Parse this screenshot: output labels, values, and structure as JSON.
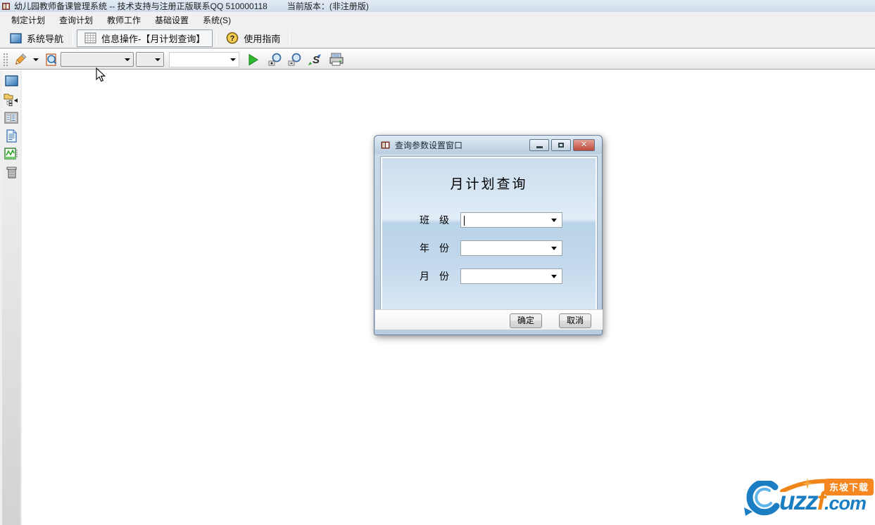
{
  "app": {
    "title": "幼儿园教师备课管理系统 -- 技术支持与注册正版联系QQ 510000118",
    "version": "当前版本：(非注册版)"
  },
  "menu": {
    "items": [
      "制定计划",
      "查询计划",
      "教师工作",
      "基础设置",
      "系统(S)"
    ]
  },
  "navbar": {
    "system_nav_label": "系统导航",
    "info_tab_label": "信息操作-【月计划查询】",
    "guide_label": "使用指南"
  },
  "toolbar": {
    "combo1_value": "",
    "combo2_value": "",
    "combo3_value": ""
  },
  "dialog": {
    "title": "查询参数设置窗口",
    "heading": "月计划查询",
    "fields": [
      {
        "label": "班　级",
        "value": ""
      },
      {
        "label": "年　份",
        "value": ""
      },
      {
        "label": "月　份",
        "value": ""
      }
    ],
    "ok_label": "确定",
    "cancel_label": "取消"
  },
  "watermark": {
    "brand_prefix": "uzz",
    "brand_f": "f",
    "suffix": ".com",
    "badge": "东坡下载"
  },
  "colors": {
    "accent_blue": "#1b7ec3",
    "accent_orange": "#f08519",
    "close_red": "#bf4a3b",
    "titlebar_blue": "#cfdcea"
  }
}
